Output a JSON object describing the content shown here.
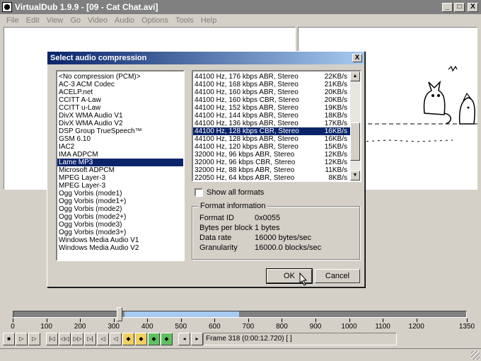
{
  "window": {
    "title": "VirtualDub 1.9.9 - [09 - Cat Chat.avi]",
    "min": "_",
    "max": "□",
    "close": "X"
  },
  "menu": [
    "File",
    "Edit",
    "View",
    "Go",
    "Video",
    "Audio",
    "Options",
    "Tools",
    "Help"
  ],
  "dialog": {
    "title": "Select audio compression",
    "close": "X",
    "codecs": [
      "<No compression (PCM)>",
      "AC-3 ACM Codec",
      "ACELP.net",
      "CCITT A-Law",
      "CCITT u-Law",
      "DivX WMA Audio V1",
      "DivX WMA Audio V2",
      "DSP Group TrueSpeech™",
      "GSM 6.10",
      "IAC2",
      "IMA ADPCM",
      "Lame MP3",
      "Microsoft ADPCM",
      "MPEG Layer-3",
      "MPEG Layer-3",
      "Ogg Vorbis (mode1)",
      "Ogg Vorbis (mode1+)",
      "Ogg Vorbis (mode2)",
      "Ogg Vorbis (mode2+)",
      "Ogg Vorbis (mode3)",
      "Ogg Vorbis (mode3+)",
      "Windows Media Audio V1",
      "Windows Media Audio V2"
    ],
    "selected_codec": 11,
    "formats": [
      {
        "name": "44100 Hz, 176 kbps ABR, Stereo",
        "rate": "22KB/s"
      },
      {
        "name": "44100 Hz, 168 kbps ABR, Stereo",
        "rate": "21KB/s"
      },
      {
        "name": "44100 Hz, 160 kbps ABR, Stereo",
        "rate": "20KB/s"
      },
      {
        "name": "44100 Hz, 160 kbps CBR, Stereo",
        "rate": "20KB/s"
      },
      {
        "name": "44100 Hz, 152 kbps ABR, Stereo",
        "rate": "19KB/s"
      },
      {
        "name": "44100 Hz, 144 kbps ABR, Stereo",
        "rate": "18KB/s"
      },
      {
        "name": "44100 Hz, 136 kbps ABR, Stereo",
        "rate": "17KB/s"
      },
      {
        "name": "44100 Hz, 128 kbps CBR, Stereo",
        "rate": "16KB/s"
      },
      {
        "name": "44100 Hz, 128 kbps ABR, Stereo",
        "rate": "16KB/s"
      },
      {
        "name": "44100 Hz, 120 kbps ABR, Stereo",
        "rate": "15KB/s"
      },
      {
        "name": "32000 Hz, 96 kbps ABR, Stereo",
        "rate": "12KB/s"
      },
      {
        "name": "32000 Hz, 96 kbps CBR, Stereo",
        "rate": "12KB/s"
      },
      {
        "name": "32000 Hz, 88 kbps ABR, Stereo",
        "rate": "11KB/s"
      },
      {
        "name": "22050 Hz, 64 kbps ABR, Stereo",
        "rate": "8KB/s"
      }
    ],
    "selected_format": 7,
    "show_all_label": "Show all formats",
    "show_all_checked": false,
    "info_title": "Format information",
    "info": [
      {
        "key": "Format ID",
        "value": "0x0055"
      },
      {
        "key": "Bytes per block",
        "value": "1 bytes"
      },
      {
        "key": "Data rate",
        "value": "16000 bytes/sec"
      },
      {
        "key": "Granularity",
        "value": "16000.0 blocks/sec"
      }
    ],
    "ok_label": "OK",
    "cancel_label": "Cancel"
  },
  "timeline": {
    "max_frame": 1350,
    "position": 318,
    "selection_start": 330,
    "selection_end": 670,
    "ticks": [
      0,
      100,
      200,
      300,
      400,
      500,
      600,
      700,
      800,
      900,
      1000,
      1100,
      1200,
      1350
    ]
  },
  "toolbar_icons": [
    "stop-icon",
    "play-input-icon",
    "play-output-icon",
    "go-start-icon",
    "prev-keyframe-icon",
    "next-keyframe-icon",
    "go-end-icon",
    "scene-back-icon",
    "scene-forward-icon",
    "mark-in-icon",
    "mark-out-icon",
    "set-mark-in-icon",
    "set-mark-out-icon"
  ],
  "frame_readout": "Frame 318 (0:00:12.720) [ ]"
}
